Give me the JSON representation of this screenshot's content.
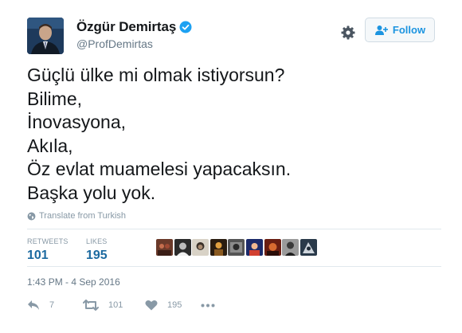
{
  "author": {
    "display_name": "Özgür Demirtaş",
    "handle": "@ProfDemirtas",
    "verified": true,
    "avatar_icon": "profile-photo"
  },
  "header": {
    "follow_label": "Follow",
    "settings_icon": "gear-icon"
  },
  "tweet": {
    "lines": [
      "Güçlü ülke mi olmak istiyorsun?",
      "Bilime,",
      "İnovasyona,",
      "Akıla,",
      "Öz evlat muamelesi yapacaksın.",
      "Başka yolu yok."
    ],
    "translate_label": "Translate from Turkish",
    "timestamp": "1:43 PM - 4 Sep 2016"
  },
  "stats": {
    "retweets_label": "RETWEETS",
    "retweets_value": "101",
    "likes_label": "LIKES",
    "likes_value": "195",
    "liker_avatar_count": 9
  },
  "actions": {
    "reply_count": "7",
    "retweet_count": "101",
    "like_count": "195"
  },
  "colors": {
    "link_blue": "#1c94e0",
    "stat_blue": "#1c6aa0",
    "verified_blue": "#1da1f2",
    "muted": "#8899a6"
  }
}
